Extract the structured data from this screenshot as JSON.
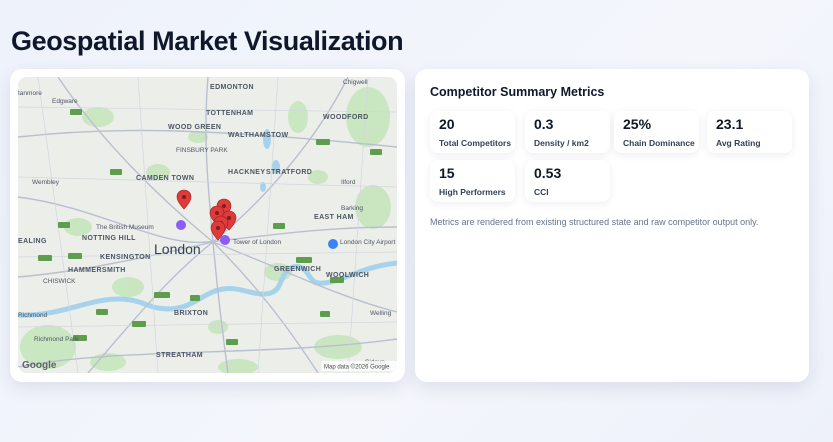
{
  "page": {
    "title": "Geospatial Market Visualization"
  },
  "map": {
    "labels": {
      "edmonton": "EDMONTON",
      "chigwell": "Chigwell",
      "edgware": "Edgware",
      "stanmore": "tanmore",
      "tottenham": "TOTTENHAM",
      "woodford": "WOODFORD",
      "wood_green": "WOOD GREEN",
      "walthamstow": "WALTHAMSTOW",
      "finsbury_park": "FINSBURY PARK",
      "wembley": "Wembley",
      "ilford": "Ilford",
      "camden_town": "CAMDEN TOWN",
      "hackney": "HACKNEY",
      "stratford": "STRATFORD",
      "barking": "Barking",
      "east_ham": "EAST HAM",
      "british_museum": "The British Museum",
      "ealing": "EALING",
      "notting_hill": "NOTTING HILL",
      "london": "London",
      "tower_of_london": "Tower of London",
      "london_city_airport": "London City Airport",
      "kensington": "KENSINGTON",
      "greenwich": "GREENWICH",
      "woolwich": "WOOLWICH",
      "hammersmith": "HAMMERSMITH",
      "chiswick": "CHISWICK",
      "richmond": "Richmond",
      "brixton": "BRIXTON",
      "welling": "Welling",
      "richmond_park": "Richmond Park",
      "streatham": "STREATHAM",
      "sidcup": "Sidcup"
    },
    "google_logo": "Google",
    "attribution": "Map data ©2026 Google",
    "marker_count": 6
  },
  "metrics": {
    "title": "Competitor Summary Metrics",
    "tiles": [
      {
        "value": "20",
        "label": "Total Competitors"
      },
      {
        "value": "0.3",
        "label": "Density / km2"
      },
      {
        "value": "25%",
        "label": "Chain Dominance"
      },
      {
        "value": "23.1",
        "label": "Avg Rating"
      },
      {
        "value": "15",
        "label": "High Performers"
      },
      {
        "value": "0.53",
        "label": "CCI"
      }
    ],
    "note": "Metrics are rendered from existing structured state and raw competitor output only."
  }
}
